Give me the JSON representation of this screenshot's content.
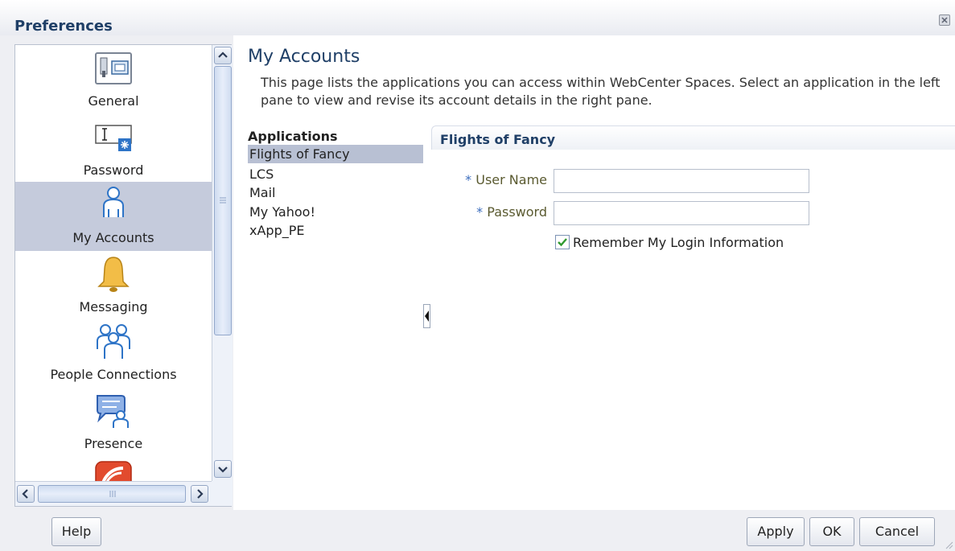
{
  "dialog": {
    "title": "Preferences"
  },
  "nav": {
    "items": [
      {
        "label": "General",
        "icon": "general-settings-icon",
        "selected": false
      },
      {
        "label": "Password",
        "icon": "password-icon",
        "selected": false
      },
      {
        "label": "My Accounts",
        "icon": "user-accounts-icon",
        "selected": true
      },
      {
        "label": "Messaging",
        "icon": "bell-icon",
        "selected": false
      },
      {
        "label": "People Connections",
        "icon": "people-group-icon",
        "selected": false
      },
      {
        "label": "Presence",
        "icon": "presence-chat-icon",
        "selected": false
      },
      {
        "label": "",
        "icon": "feed-icon",
        "selected": false
      }
    ]
  },
  "main": {
    "title": "My Accounts",
    "description": "This page lists the applications you can access within WebCenter Spaces. Select an application in the left pane to view and revise its account details in the right pane.",
    "applications": {
      "header": "Applications",
      "items": [
        "Flights of Fancy",
        "LCS",
        "Mail",
        "My Yahoo!",
        "xApp_PE"
      ],
      "selected_index": 0
    },
    "detail": {
      "title": "Flights of Fancy",
      "user_name_label": "User Name",
      "user_name_value": "",
      "password_label": "Password",
      "password_value": "",
      "required_marker": "*",
      "remember_label": "Remember My Login Information",
      "remember_checked": true
    }
  },
  "footer": {
    "help_label": "Help",
    "apply_label": "Apply",
    "ok_label": "OK",
    "cancel_label": "Cancel"
  },
  "colors": {
    "title_text": "#1f3f67",
    "selected_nav": "#c5cbdc",
    "selected_app": "#b8c0d3",
    "required_marker": "#3c6dbd"
  }
}
